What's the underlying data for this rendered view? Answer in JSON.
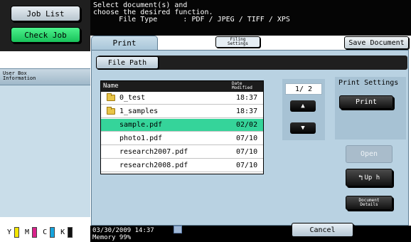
{
  "left": {
    "job_list": "Job List",
    "check_job": "Check Job",
    "user_box_info_line1": "User Box",
    "user_box_info_line2": "Information"
  },
  "toner": {
    "y": "Y",
    "m": "M",
    "c": "C",
    "k": "K",
    "colors": {
      "y": "#f4e600",
      "m": "#d9228b",
      "c": "#16a4dd",
      "k": "#111111"
    }
  },
  "message": {
    "line1": "Select document(s) and",
    "line2": "choose the desired function.",
    "line3": "      File Type      : PDF / JPEG / TIFF / XPS"
  },
  "tabs": {
    "print": "Print",
    "filing_line1": "Filing",
    "filing_line2": "Settings",
    "save_document": "Save Document"
  },
  "file_path_button": "File Path",
  "file_list": {
    "header_name": "Name",
    "header_date_line1": "Date",
    "header_date_line2": "Modified",
    "rows": [
      {
        "name": "0_test",
        "date": "18:37",
        "folder": true
      },
      {
        "name": "1_samples",
        "date": "18:37",
        "folder": true
      },
      {
        "name": "sample.pdf",
        "date": "02/02",
        "folder": false,
        "selected": true
      },
      {
        "name": "photo1.pdf",
        "date": "07/10",
        "folder": false
      },
      {
        "name": "research2007.pdf",
        "date": "07/10",
        "folder": false
      },
      {
        "name": "research2008.pdf",
        "date": "07/10",
        "folder": false
      }
    ]
  },
  "pager": {
    "page": "1/  2",
    "up_icon": "arrow-up-icon",
    "down_icon": "arrow-down-icon"
  },
  "print_settings": {
    "label": "Print Settings",
    "print_button": "Print"
  },
  "actions": {
    "open": "Open",
    "up_to": "Up h",
    "doc_details_line1": "Document",
    "doc_details_line2": "Details"
  },
  "status": {
    "datetime": "03/30/2009    14:37",
    "memory": "Memory        99%",
    "cancel": "Cancel"
  }
}
